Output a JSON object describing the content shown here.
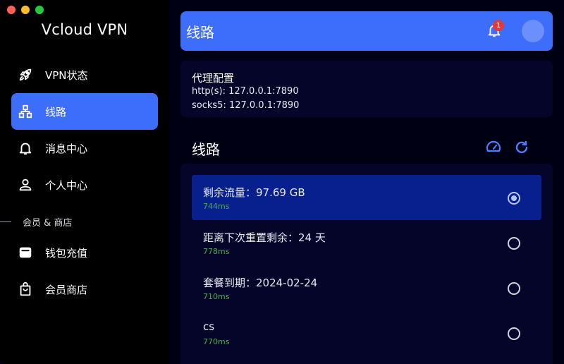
{
  "app": {
    "title": "Vcloud VPN"
  },
  "sidebar": {
    "items": [
      {
        "label": "VPN状态",
        "icon": "rocket-icon",
        "active": false
      },
      {
        "label": "线路",
        "icon": "network-icon",
        "active": true
      },
      {
        "label": "消息中心",
        "icon": "bell-icon",
        "active": false
      },
      {
        "label": "个人中心",
        "icon": "person-icon",
        "active": false
      }
    ],
    "section_label": "会员 & 商店",
    "shop_items": [
      {
        "label": "钱包充值",
        "icon": "wallet-icon"
      },
      {
        "label": "会员商店",
        "icon": "shopping-bag-icon"
      }
    ]
  },
  "header": {
    "title": "线路",
    "notification_count": "1"
  },
  "proxy": {
    "title": "代理配置",
    "http": "http(s): 127.0.0.1:7890",
    "socks": "socks5: 127.0.0.1:7890"
  },
  "routes": {
    "title": "线路",
    "items": [
      {
        "name": "剩余流量：97.69 GB",
        "latency": "744ms",
        "selected": true
      },
      {
        "name": "距离下次重置剩余：24 天",
        "latency": "778ms",
        "selected": false
      },
      {
        "name": "套餐到期：2024-02-24",
        "latency": "710ms",
        "selected": false
      },
      {
        "name": "cs",
        "latency": "770ms",
        "selected": false
      }
    ]
  },
  "colors": {
    "accent": "#3d6dfb",
    "selected_row": "#08208e",
    "latency": "#4caf50",
    "badge": "#e53935"
  }
}
